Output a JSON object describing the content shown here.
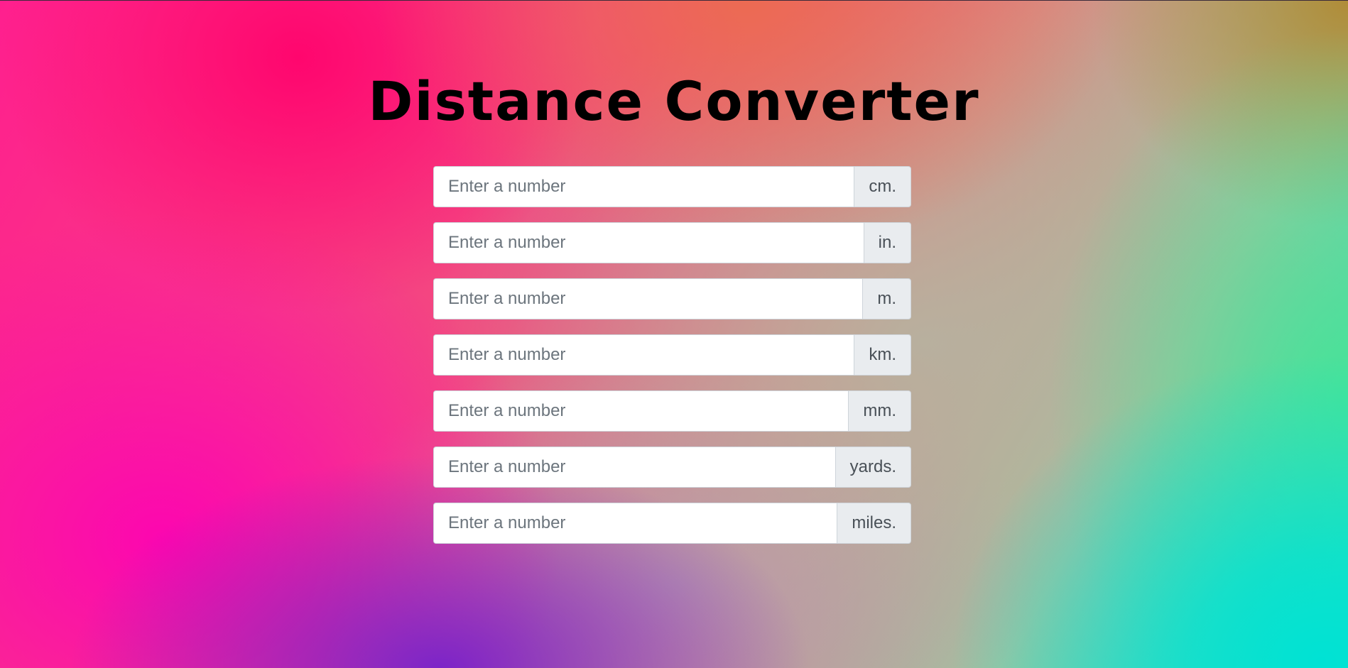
{
  "page": {
    "title": "Distance Converter"
  },
  "converter": {
    "fields": [
      {
        "placeholder": "Enter a number",
        "value": "",
        "unit": "cm."
      },
      {
        "placeholder": "Enter a number",
        "value": "",
        "unit": "in."
      },
      {
        "placeholder": "Enter a number",
        "value": "",
        "unit": "m."
      },
      {
        "placeholder": "Enter a number",
        "value": "",
        "unit": "km."
      },
      {
        "placeholder": "Enter a number",
        "value": "",
        "unit": "mm."
      },
      {
        "placeholder": "Enter a number",
        "value": "",
        "unit": "yards."
      },
      {
        "placeholder": "Enter a number",
        "value": "",
        "unit": "miles."
      }
    ]
  },
  "colors": {
    "title_text": "#000000",
    "input_background": "#ffffff",
    "input_border": "#ced4da",
    "placeholder_text": "#6c757d",
    "unit_addon_background": "#e9ecef",
    "unit_addon_text": "#495057",
    "background_gradient": [
      "#ff0a6e",
      "#fc06b0",
      "#7c24c8",
      "#ec6c50",
      "#b08c38",
      "#46e496",
      "#00e2d4"
    ]
  }
}
